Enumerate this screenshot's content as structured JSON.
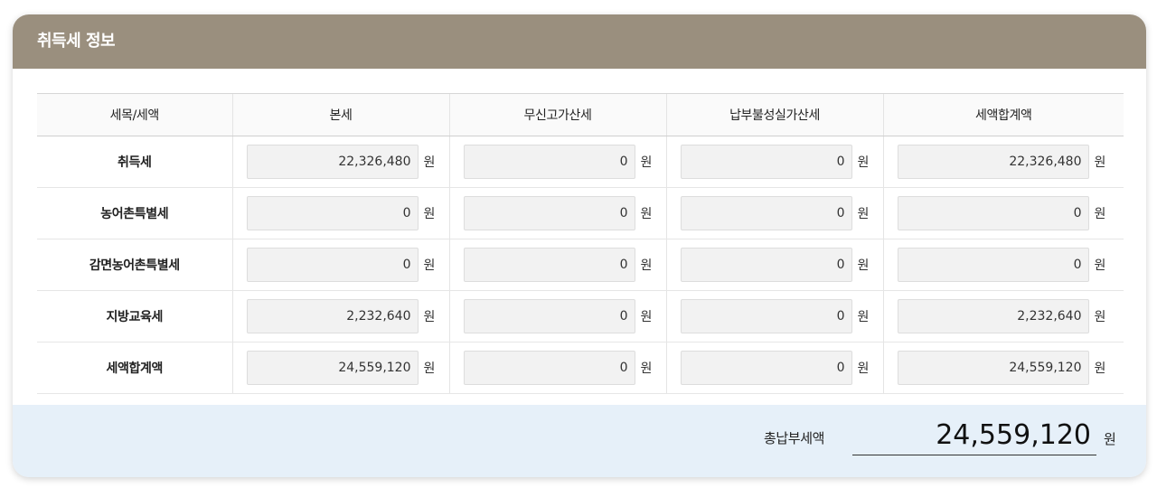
{
  "panel": {
    "title": "취득세 정보"
  },
  "table": {
    "headers": [
      "세목/세액",
      "본세",
      "무신고가산세",
      "납부불성실가산세",
      "세액합계액"
    ],
    "unit": "원",
    "rows": [
      {
        "label": "취득세",
        "values": [
          "22,326,480",
          "0",
          "0",
          "22,326,480"
        ]
      },
      {
        "label": "농어촌특별세",
        "values": [
          "0",
          "0",
          "0",
          "0"
        ]
      },
      {
        "label": "감면농어촌특별세",
        "values": [
          "0",
          "0",
          "0",
          "0"
        ]
      },
      {
        "label": "지방교육세",
        "values": [
          "2,232,640",
          "0",
          "0",
          "2,232,640"
        ]
      },
      {
        "label": "세액합계액",
        "values": [
          "24,559,120",
          "0",
          "0",
          "24,559,120"
        ]
      }
    ]
  },
  "total": {
    "label": "총납부세액",
    "value": "24,559,120",
    "unit": "원"
  }
}
